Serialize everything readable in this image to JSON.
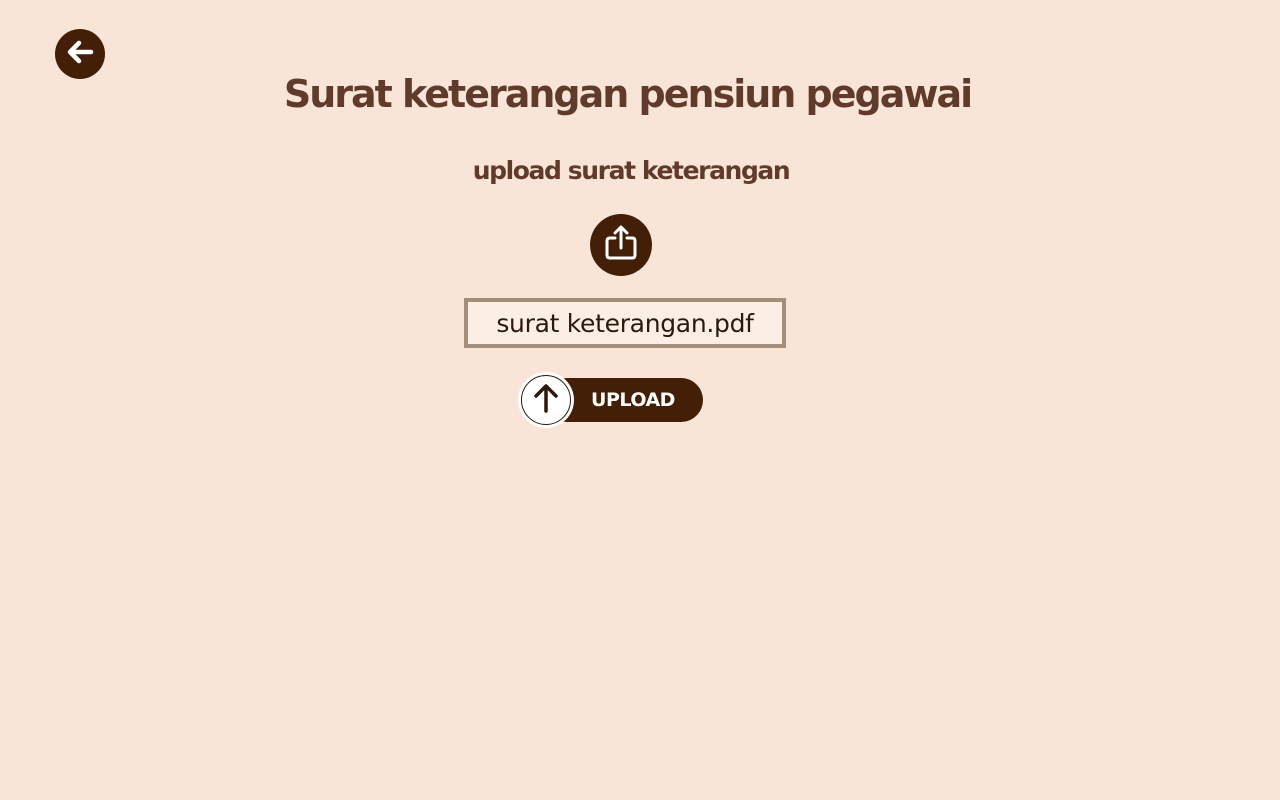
{
  "header": {
    "back_icon": "arrow-left-icon"
  },
  "main": {
    "title": "Surat keterangan pensiun pegawai",
    "subtitle": "upload surat keterangan",
    "share_icon": "share-upload-icon",
    "file_name": "surat keterangan.pdf",
    "upload_label": "UPLOAD",
    "upload_icon": "arrow-up-icon"
  },
  "colors": {
    "background": "#f8e5d7",
    "primary": "#421f06",
    "title_text": "#603b2b",
    "field_border": "#a38e79"
  }
}
